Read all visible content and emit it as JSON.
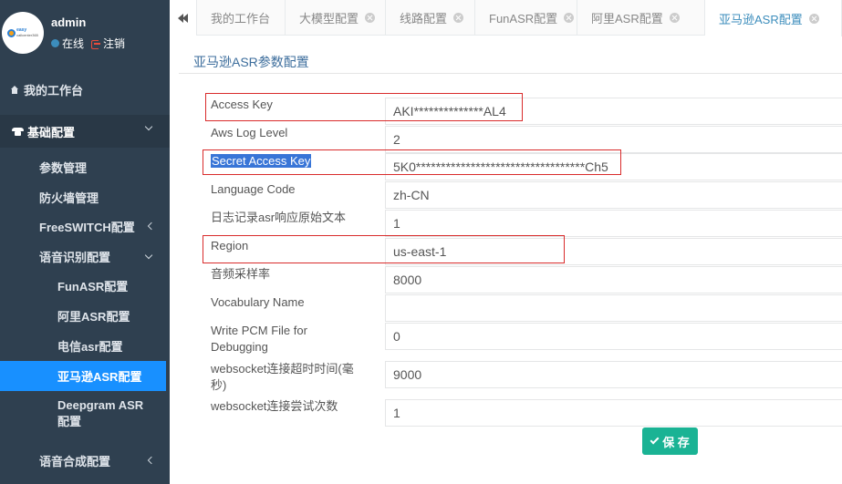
{
  "user": {
    "name": "admin",
    "status_online": "在线",
    "logout": "注销",
    "logo_text_line1": "easy",
    "logo_text_line2": "callcenter365"
  },
  "sidebar": {
    "workbench": "我的工作台",
    "group_basic": "基础配置",
    "items": [
      "参数管理",
      "防火墙管理",
      "FreeSWITCH配置",
      "语音识别配置"
    ],
    "asr_items": [
      "FunASR配置",
      "阿里ASR配置",
      "电信asr配置",
      "亚马逊ASR配置",
      "Deepgram ASR",
      "配置"
    ],
    "tts": "语音合成配置"
  },
  "tabs": [
    {
      "label": "我的工作台",
      "closable": false
    },
    {
      "label": "大模型配置",
      "closable": true
    },
    {
      "label": "线路配置",
      "closable": true
    },
    {
      "label": "FunASR配置",
      "closable": true
    },
    {
      "label": "阿里ASR配置",
      "closable": true
    },
    {
      "label": "亚马逊ASR配置",
      "closable": true,
      "active": true
    }
  ],
  "page": {
    "title": "亚马逊ASR参数配置",
    "save_label": "保 存"
  },
  "form": [
    {
      "label": "Access Key",
      "value": "AKI**************AL4"
    },
    {
      "label": "Aws Log Level",
      "value": "2"
    },
    {
      "label": "Secret Access Key",
      "value": "5K0**********************************Ch5"
    },
    {
      "label": "Language Code",
      "value": "zh-CN"
    },
    {
      "label": "日志记录asr响应原始文本",
      "value": "1"
    },
    {
      "label": "Region",
      "value": "us-east-1"
    },
    {
      "label": "音频采样率",
      "value": "8000"
    },
    {
      "label": "Vocabulary Name",
      "value": ""
    },
    {
      "label": "Write PCM File for",
      "label2": "Debugging",
      "value": "0"
    },
    {
      "label": "websocket连接超时时间(毫",
      "label2": "秒)",
      "value": "9000"
    },
    {
      "label": "websocket连接尝试次数",
      "value": "1"
    }
  ],
  "colors": {
    "sidebar_bg": "#2f4050",
    "active_item": "#1890ff",
    "save_button": "#1ab394",
    "highlight_border": "#d92b2b"
  }
}
